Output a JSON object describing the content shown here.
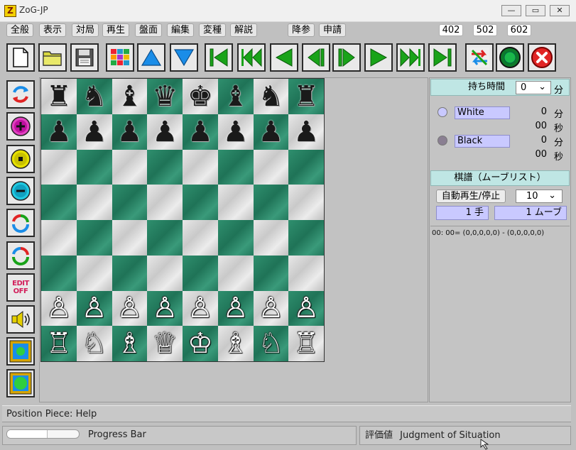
{
  "window": {
    "title": "ZoG-JP",
    "app_icon_glyph": "Z"
  },
  "window_controls": {
    "minimize": "—",
    "restore": "▭",
    "close": "✕"
  },
  "menu": {
    "items": [
      "全般",
      "表示",
      "対局",
      "再生",
      "盤面",
      "編集",
      "変種",
      "解説"
    ],
    "resign": "降参",
    "request": "申請",
    "numbers": [
      "402",
      "502",
      "602"
    ]
  },
  "toolbar_icons": [
    "new-file-icon",
    "open-folder-icon",
    "save-icon",
    "palette-grid-icon",
    "arrow-up-icon",
    "arrow-down-icon",
    "first-move-icon",
    "back-fast-icon",
    "back-icon",
    "back-step-icon",
    "forward-step-icon",
    "forward-icon",
    "forward-fast-icon",
    "last-move-icon",
    "swap-sides-icon",
    "go-icon",
    "stop-icon"
  ],
  "left_toolbar_icons": [
    "rotate-board-icon",
    "add-icon",
    "stop-dot-icon",
    "remove-icon",
    "cycle-icon",
    "cycle-reverse-icon",
    "edit-off-icon",
    "sound-icon",
    "fit-board-icon",
    "board-view-icon"
  ],
  "left_toolbar_text": {
    "edit_off": "EDIT\nOFF"
  },
  "board": {
    "rows": [
      [
        "♜",
        "♞",
        "♝",
        "♛",
        "♚",
        "♝",
        "♞",
        "♜"
      ],
      [
        "♟",
        "♟",
        "♟",
        "♟",
        "♟",
        "♟",
        "♟",
        "♟"
      ],
      [
        "",
        "",
        "",
        "",
        "",
        "",
        "",
        ""
      ],
      [
        "",
        "",
        "",
        "",
        "",
        "",
        "",
        ""
      ],
      [
        "",
        "",
        "",
        "",
        "",
        "",
        "",
        ""
      ],
      [
        "",
        "",
        "",
        "",
        "",
        "",
        "",
        ""
      ],
      [
        "♙",
        "♙",
        "♙",
        "♙",
        "♙",
        "♙",
        "♙",
        "♙"
      ],
      [
        "♖",
        "♘",
        "♗",
        "♕",
        "♔",
        "♗",
        "♘",
        "♖"
      ]
    ]
  },
  "clock": {
    "header": "持ち時間",
    "limit_value": "0",
    "limit_unit": "分",
    "players": [
      {
        "name": "White",
        "minutes": "0",
        "min_unit": "分",
        "seconds": "00",
        "sec_unit": "秒",
        "color": "#c9c9ff"
      },
      {
        "name": "Black",
        "minutes": "0",
        "min_unit": "分",
        "seconds": "00",
        "sec_unit": "秒",
        "color": "#8a7f92"
      }
    ]
  },
  "movelist": {
    "header": "棋譜（ムーブリスト）",
    "autoplay_label": "自動再生/停止",
    "speed_value": "10",
    "hand_value": "1 手",
    "move_value": "1 ムーブ",
    "entries": [
      "00: 00= (0,0,0,0,0) - (0,0,0,0,0)"
    ]
  },
  "status": {
    "help_text": "Position Piece: Help",
    "progress_label": "Progress Bar",
    "progress": 0.55,
    "evaluation_label": "評価値",
    "evaluation_text": "Judgment of Situation"
  },
  "colors": {
    "board_dark": "#1f7357",
    "board_light": "#d6d6d6",
    "panel_header": "#bfe6e4",
    "name_box": "#c9c9ff"
  }
}
